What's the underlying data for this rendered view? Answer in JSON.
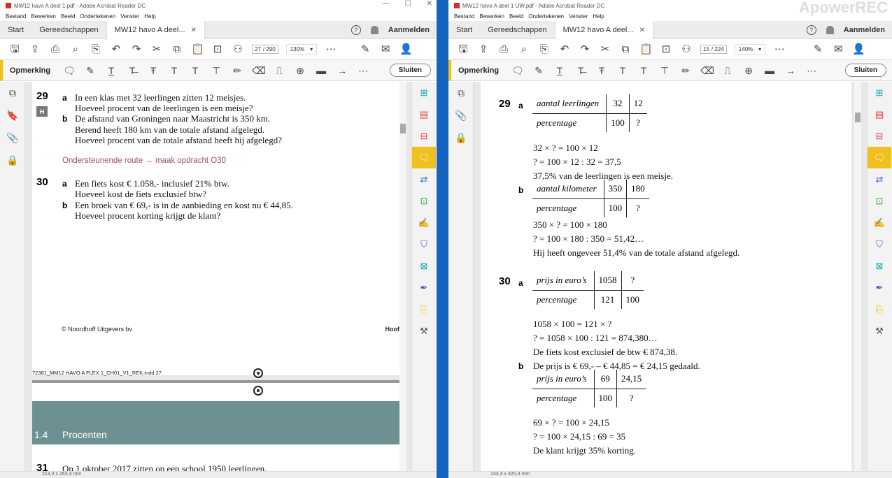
{
  "left_window": {
    "title": "MW12 havo A deel 1.pdf - Adobe Acrobat Reader DC",
    "menu": [
      "Bestand",
      "Bewerken",
      "Beeld",
      "Ondertekenen",
      "Venster",
      "Help"
    ],
    "tabs": {
      "start": "Start",
      "tools": "Gereedschappen",
      "doc": "MW12 havo A deel..."
    },
    "signin": "Aanmelden",
    "page_current": "27",
    "page_total": "/ 290",
    "zoom": "130%",
    "comment_label": "Opmerking",
    "close": "Sluiten",
    "status": "213,3 x 263,3 mm",
    "content": {
      "q29": "29",
      "h_badge": "H",
      "q29a": "a",
      "q29a_l1": "In een klas met 32 leerlingen zitten 12 meisjes.",
      "q29a_l2": "Hoeveel procent van de leerlingen is een meisje?",
      "q29b": "b",
      "q29b_l1": "De afstand van Groningen naar Maastricht is 350 km.",
      "q29b_l2": "Berend heeft 180 km van de totale afstand afgelegd.",
      "q29b_l3": "Hoeveel procent van de totale afstand heeft hij afgelegd?",
      "route": "Ondersteunende route → maak opdracht O30",
      "q30": "30",
      "q30a": "a",
      "q30a_l1": "Een fiets kost € 1.058,- inclusief 21% btw.",
      "q30a_l2": "Hoeveel kost de fiets exclusief btw?",
      "q30b": "b",
      "q30b_l1": "Een broek van € 69,- is in de aanbieding en kost nu € 44,85.",
      "q30b_l2": "Hoeveel procent korting krijgt de klant?",
      "footer_left": "© Noordhoff Uitgevers bv",
      "footer_right": "Hoof",
      "crop_text": "72381_MM12 HAVO A FLEX 1_CH01_V1_REK.indd   27",
      "section_num": "1.4",
      "section_title": "Procenten",
      "q31": "31",
      "q31_l1": "Op 1 oktober 2017 zitten op een school 1950 leerlingen."
    }
  },
  "right_window": {
    "title": "MW12 havo A deel 1 UW.pdf - Adobe Acrobat Reader DC",
    "menu": [
      "Bestand",
      "Bewerken",
      "Beeld",
      "Ondertekenen",
      "Venster",
      "Help"
    ],
    "tabs": {
      "start": "Start",
      "tools": "Gereedschappen",
      "doc": "MW12 havo A deel..."
    },
    "signin": "Aanmelden",
    "page_current": "15",
    "page_total": "/ 224",
    "zoom": "140%",
    "comment_label": "Opmerking",
    "close": "Sluiten",
    "status": "233,3 x 320,3 mm",
    "watermark": "ApowerREC",
    "content": {
      "q29": "29",
      "q29a": "a",
      "t1": {
        "r1": [
          "aantal leerlingen",
          "32",
          "12"
        ],
        "r2": [
          "percentage",
          "100",
          "?"
        ]
      },
      "a1": "32 × ? = 100 × 12",
      "a2": "? = 100 × 12 : 32 = 37,5",
      "a3": "37,5% van de leerlingen is een meisje.",
      "q29b": "b",
      "t2": {
        "r1": [
          "aantal kilometer",
          "350",
          "180"
        ],
        "r2": [
          "percentage",
          "100",
          "?"
        ]
      },
      "b1": "350 × ? = 100 × 180",
      "b2": "? = 100 × 180 : 350 = 51,42…",
      "b3": "Hij heeft ongeveer 51,4% van de totale afstand afgelegd.",
      "q30": "30",
      "q30a": "a",
      "t3": {
        "r1": [
          "prijs in euro’s",
          "1058",
          "?"
        ],
        "r2": [
          "percentage",
          "121",
          "100"
        ]
      },
      "c1": "1058 × 100 = 121 × ?",
      "c2": "? = 1058 × 100 : 121 = 874,380…",
      "c3": "De fiets kost exclusief de btw € 874,38.",
      "q30b": "b",
      "d0": "De prijs is € 69,- – € 44,85 = € 24,15 gedaald.",
      "t4": {
        "r1": [
          "prijs in euro’s",
          "69",
          "24,15"
        ],
        "r2": [
          "percentage",
          "100",
          "?"
        ]
      },
      "d1": "69 × ? = 100 × 24,15",
      "d2": "? = 100 × 24,15 : 69 = 35",
      "d3": "De klant krijgt 35% korting."
    }
  }
}
